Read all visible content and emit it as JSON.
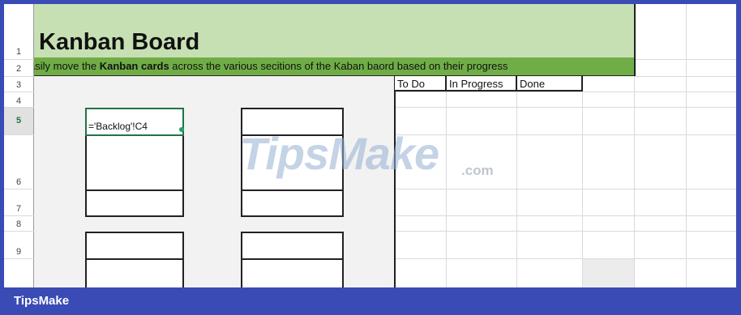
{
  "title": "Kanban Board",
  "subtitle": {
    "prefix": "asily move the ",
    "bold": "Kanban cards",
    "suffix": " across the various secitions of the Kaban baord based on their progress"
  },
  "columns": [
    "To Do",
    "In Progress",
    "Done"
  ],
  "row_numbers": [
    "1",
    "2",
    "3",
    "4",
    "5",
    "6",
    "7",
    "8",
    "9"
  ],
  "active_row": "5",
  "selected_cell_formula": "='Backlog'!C4",
  "watermark": "TipsMake",
  "watermark_suffix": ".com",
  "footer_brand": "TipsMake",
  "colors": {
    "title_band": "#c6e0b4",
    "subtitle_band": "#70ad47",
    "frame": "#3a4bb6",
    "selection": "#217346"
  }
}
